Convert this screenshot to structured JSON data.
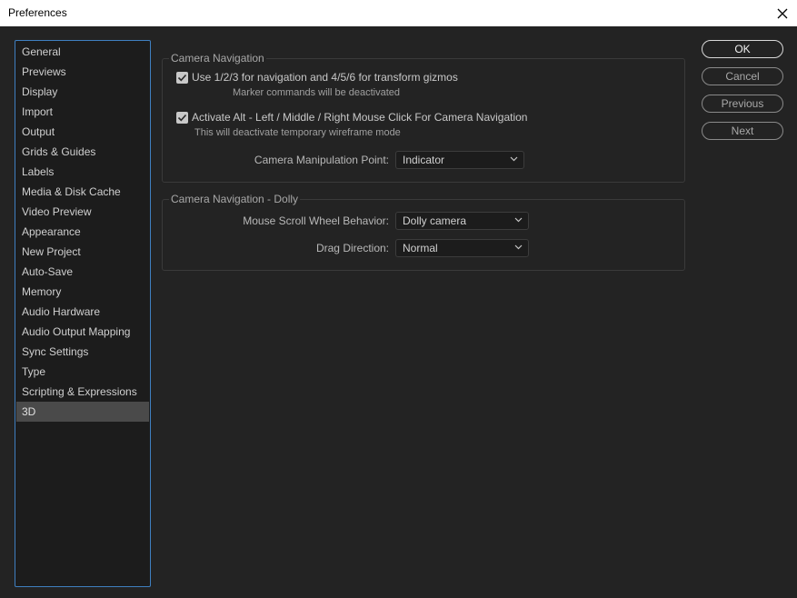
{
  "window": {
    "title": "Preferences"
  },
  "sidebar": {
    "items": [
      {
        "label": "General"
      },
      {
        "label": "Previews"
      },
      {
        "label": "Display"
      },
      {
        "label": "Import"
      },
      {
        "label": "Output"
      },
      {
        "label": "Grids & Guides"
      },
      {
        "label": "Labels"
      },
      {
        "label": "Media & Disk Cache"
      },
      {
        "label": "Video Preview"
      },
      {
        "label": "Appearance"
      },
      {
        "label": "New Project"
      },
      {
        "label": "Auto-Save"
      },
      {
        "label": "Memory"
      },
      {
        "label": "Audio Hardware"
      },
      {
        "label": "Audio Output Mapping"
      },
      {
        "label": "Sync Settings"
      },
      {
        "label": "Type"
      },
      {
        "label": "Scripting & Expressions"
      },
      {
        "label": "3D",
        "selected": true
      }
    ]
  },
  "camera_navigation": {
    "title": "Camera Navigation",
    "option1": {
      "checked": true,
      "label": "Use 1/2/3 for navigation and 4/5/6 for transform gizmos",
      "note": "Marker commands will be deactivated"
    },
    "option2": {
      "checked": true,
      "label": "Activate Alt - Left / Middle / Right Mouse Click For Camera Navigation",
      "note": "This will deactivate temporary wireframe mode"
    },
    "manipulation_point": {
      "label": "Camera Manipulation Point:",
      "value": "Indicator"
    }
  },
  "dolly": {
    "title": "Camera Navigation - Dolly",
    "scroll_behavior": {
      "label": "Mouse Scroll Wheel Behavior:",
      "value": "Dolly camera"
    },
    "drag_direction": {
      "label": "Drag Direction:",
      "value": "Normal"
    }
  },
  "buttons": {
    "ok": "OK",
    "cancel": "Cancel",
    "previous": "Previous",
    "next": "Next"
  },
  "colors": {
    "background": "#232323",
    "sidebar_border": "#3f7fc0",
    "selected_item": "#4a4a4a"
  }
}
